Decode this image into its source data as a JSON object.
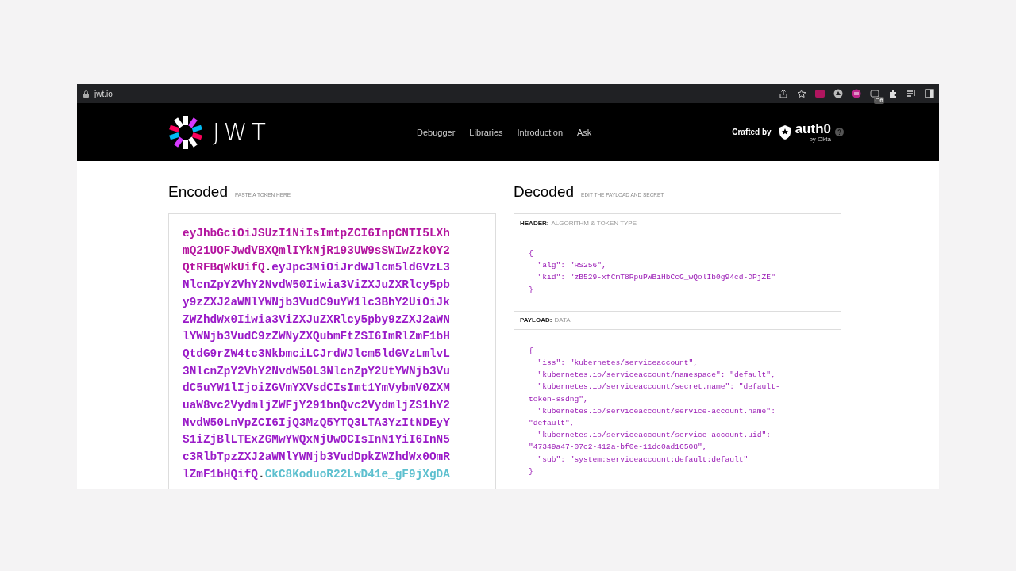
{
  "browser": {
    "url": "jwt.io",
    "extension_badge": "Off"
  },
  "nav": {
    "logo_text": "JWT",
    "links": [
      "Debugger",
      "Libraries",
      "Introduction",
      "Ask"
    ],
    "crafted_by": "Crafted by",
    "brand": "auth0",
    "brand_sub": "by Okta"
  },
  "encoded": {
    "title": "Encoded",
    "hint": "PASTE A TOKEN HERE",
    "lines": [
      [
        {
          "kind": "header",
          "text": "eyJhbGciOiJSUzI1NiIsImtpZCI6InpCNTI5LXh"
        }
      ],
      [
        {
          "kind": "header",
          "text": "mQ21UOFJwdVBXQmlIYkNjR193UW9sSWIwZzk0Y2"
        }
      ],
      [
        {
          "kind": "header",
          "text": "QtRFBqWkUifQ"
        },
        {
          "kind": "dot",
          "text": "."
        },
        {
          "kind": "payload",
          "text": "eyJpc3MiOiJrdWJlcm5ldGVzL3"
        }
      ],
      [
        {
          "kind": "payload",
          "text": "NlcnZpY2VhY2NvdW50Iiwia3ViZXJuZXRlcy5pb"
        }
      ],
      [
        {
          "kind": "payload",
          "text": "y9zZXJ2aWNlYWNjb3VudC9uYW1lc3BhY2UiOiJk"
        }
      ],
      [
        {
          "kind": "payload",
          "text": "ZWZhdWx0Iiwia3ViZXJuZXRlcy5pby9zZXJ2aWN"
        }
      ],
      [
        {
          "kind": "payload",
          "text": "lYWNjb3VudC9zZWNyZXQubmFtZSI6ImRlZmF1bH"
        }
      ],
      [
        {
          "kind": "payload",
          "text": "QtdG9rZW4tc3NkbmciLCJrdWJlcm5ldGVzLmlvL"
        }
      ],
      [
        {
          "kind": "payload",
          "text": "3NlcnZpY2VhY2NvdW50L3NlcnZpY2UtYWNjb3Vu"
        }
      ],
      [
        {
          "kind": "payload",
          "text": "dC5uYW1lIjoiZGVmYXVsdCIsImt1YmVybmV0ZXM"
        }
      ],
      [
        {
          "kind": "payload",
          "text": "uaW8vc2VydmljZWFjY291bnQvc2VydmljZS1hY2"
        }
      ],
      [
        {
          "kind": "payload",
          "text": "NvdW50LnVpZCI6IjQ3MzQ5YTQ3LTA3YzItNDEyY"
        }
      ],
      [
        {
          "kind": "payload",
          "text": "S1iZjBlLTExZGMwYWQxNjUwOCIsInN1YiI6InN5"
        }
      ],
      [
        {
          "kind": "payload",
          "text": "c3RlbTpzZXJ2aWNlYWNjb3VudDpkZWZhdWx0OmR"
        }
      ],
      [
        {
          "kind": "payload",
          "text": "lZmF1bHQifQ"
        },
        {
          "kind": "dot",
          "text": "."
        },
        {
          "kind": "signature",
          "text": "CkC8KoduoR22LwD41e_gF9jXgDA"
        }
      ]
    ]
  },
  "decoded": {
    "title": "Decoded",
    "hint": "EDIT THE PAYLOAD AND SECRET",
    "sections": [
      {
        "label": "HEADER:",
        "sublabel": "ALGORITHM & TOKEN TYPE",
        "lines": [
          "{",
          "  \"alg\": \"RS256\",",
          "  \"kid\": \"zB529-xfCmT8RpuPWBiHbCcG_wQolIb0g94cd-DPjZE\"",
          "}"
        ]
      },
      {
        "label": "PAYLOAD:",
        "sublabel": "DATA",
        "lines": [
          "{",
          "  \"iss\": \"kubernetes/serviceaccount\",",
          "  \"kubernetes.io/serviceaccount/namespace\": \"default\",",
          "  \"kubernetes.io/serviceaccount/secret.name\": \"default-",
          "token-ssdng\",",
          "  \"kubernetes.io/serviceaccount/service-account.name\":",
          "\"default\",",
          "  \"kubernetes.io/serviceaccount/service-account.uid\":",
          "\"47349a47-07c2-412a-bf0e-11dc0ad16508\",",
          "  \"sub\": \"system:serviceaccount:default:default\"",
          "}"
        ]
      }
    ]
  }
}
